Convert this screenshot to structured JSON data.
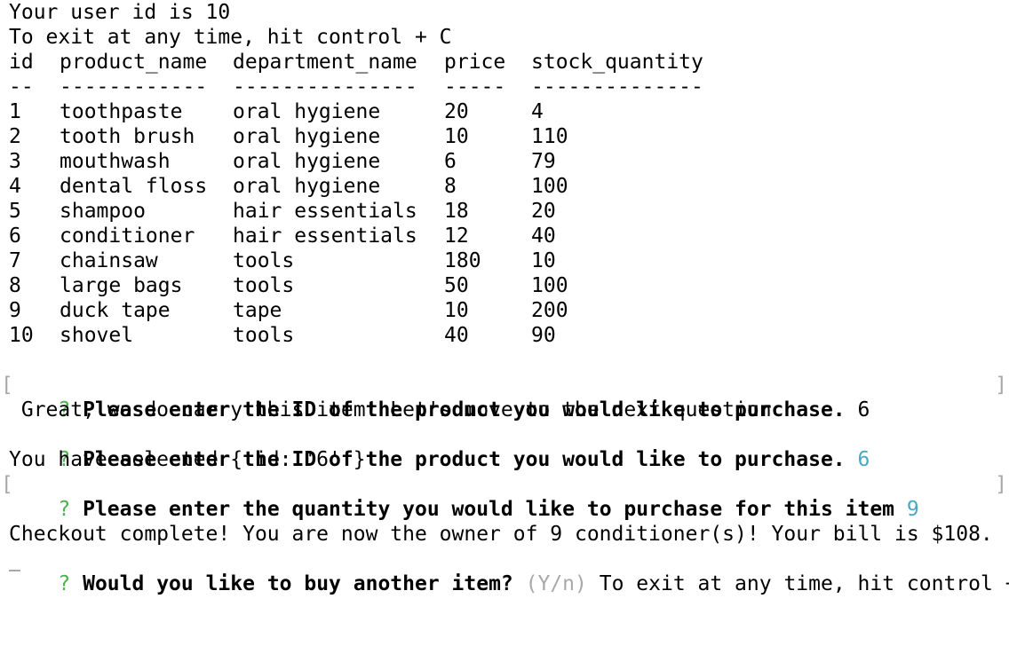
{
  "intro": {
    "user_id_line": "Your user id is 10",
    "exit_hint": "To exit at any time, hit control + C"
  },
  "table": {
    "headers": [
      "id",
      "product_name",
      "department_name",
      "price",
      "stock_quantity"
    ],
    "separators": [
      "--",
      "------------",
      "---------------",
      "-----",
      "--------------"
    ],
    "rows": [
      [
        "1",
        "toothpaste",
        "oral hygiene",
        "20",
        "4"
      ],
      [
        "2",
        "tooth brush",
        "oral hygiene",
        "10",
        "110"
      ],
      [
        "3",
        "mouthwash",
        "oral hygiene",
        "6",
        "79"
      ],
      [
        "4",
        "dental floss",
        "oral hygiene",
        "8",
        "100"
      ],
      [
        "5",
        "shampoo",
        "hair essentials",
        "18",
        "20"
      ],
      [
        "6",
        "conditioner",
        "hair essentials",
        "12",
        "40"
      ],
      [
        "7",
        "chainsaw",
        "tools",
        "180",
        "10"
      ],
      [
        "8",
        "large bags",
        "tools",
        "50",
        "100"
      ],
      [
        "9",
        "duck tape",
        "tape",
        "10",
        "200"
      ],
      [
        "10",
        "shovel",
        "tools",
        "40",
        "90"
      ]
    ]
  },
  "session": {
    "prompt_mark": "?",
    "bracket_open": "[",
    "bracket_close": "]",
    "q1_text": "Please enter the ID of the product you would like to purchase.",
    "q1_typed": "6",
    "confirm_text": "Great, we do carry this item! Let's move to the next question",
    "q1_answer_text": "Please enter the ID of the product you would like to purchase.",
    "q1_answer": "6",
    "selected_text": "You have selected { id: '6' }",
    "q2_text": "Please enter the quantity you would like to purchase for this item",
    "q2_answer": "9",
    "checkout_text": "Checkout complete! You are now the owner of 9 conditioner(s)! Your bill is $108.",
    "q3_text": "Would you like to buy another item?",
    "q3_hint": "(Y/n)",
    "q3_tail": "To exit at any time, hit control + C"
  },
  "colors": {
    "prompt_mark": "#4bb34b",
    "answer": "#4ba8bd",
    "hint": "#a8a8a8"
  }
}
